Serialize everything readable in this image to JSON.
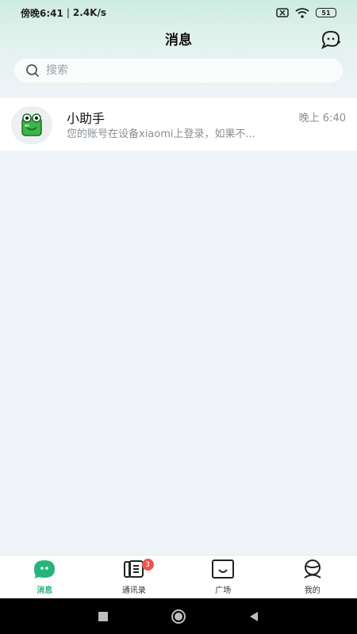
{
  "status_bar": {
    "time": "傍晚6:41",
    "network_speed": "2.4K/s",
    "battery": "51",
    "icons": [
      "sim-off-icon",
      "wifi-icon",
      "battery-icon"
    ]
  },
  "header": {
    "title": "消息",
    "right_icon": "chat-add-icon"
  },
  "search": {
    "placeholder": "搜索",
    "value": ""
  },
  "conversations": [
    {
      "name": "小助手",
      "preview": "您的账号在设备xiaomi上登录，如果不...",
      "time": "晚上 6:40",
      "avatar_icon": "frog-avatar-icon"
    }
  ],
  "tabs": [
    {
      "label": "消息",
      "icon": "message-bubble-icon",
      "active": true
    },
    {
      "label": "通讯录",
      "icon": "contacts-icon",
      "badge": "3"
    },
    {
      "label": "广场",
      "icon": "square-icon"
    },
    {
      "label": "我的",
      "icon": "profile-icon"
    }
  ],
  "colors": {
    "accent": "#27b47a",
    "badge": "#f0524f",
    "header_gradient_top": "#cdece2",
    "page_bg": "#f0f3f8"
  },
  "system_nav": [
    "recent-apps-icon",
    "home-icon",
    "back-icon"
  ]
}
